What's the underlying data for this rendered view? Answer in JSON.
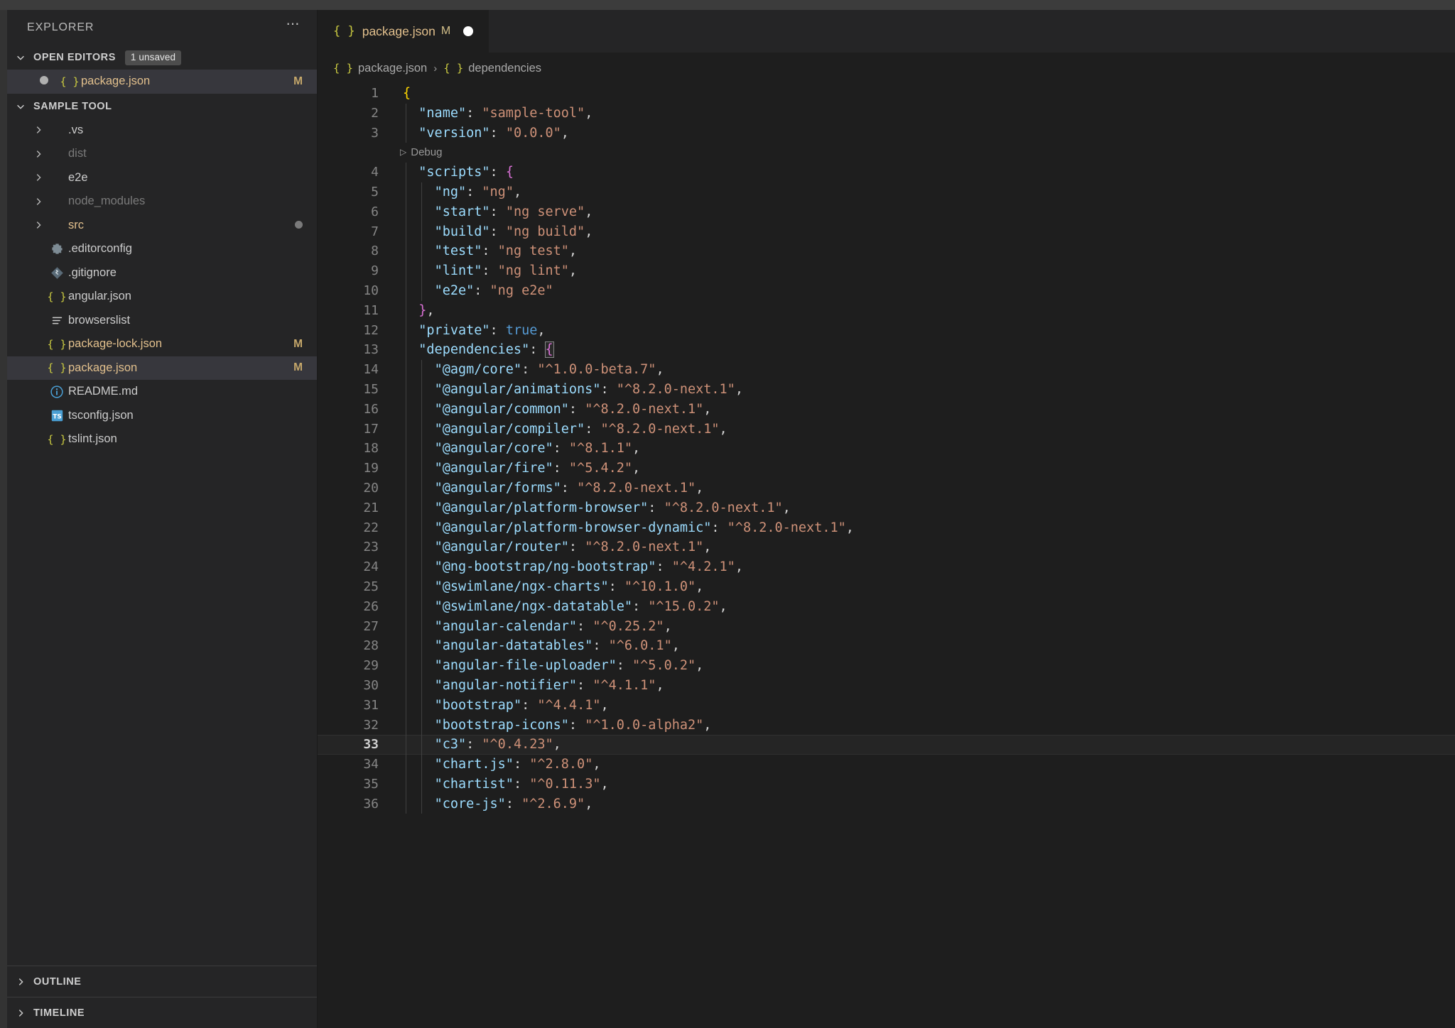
{
  "sidebar": {
    "title": "EXPLORER",
    "more_icon": "ellipsis-icon",
    "open_editors": {
      "label": "OPEN EDITORS",
      "badge": "1 unsaved",
      "items": [
        {
          "name": "package.json",
          "status": "M",
          "unsaved": true,
          "icon": "json-icon"
        }
      ]
    },
    "folder": {
      "label": "SAMPLE TOOL",
      "items": [
        {
          "label": ".vs",
          "type": "folder",
          "color": "normal",
          "status": ""
        },
        {
          "label": "dist",
          "type": "folder",
          "color": "dim",
          "status": ""
        },
        {
          "label": "e2e",
          "type": "folder",
          "color": "normal",
          "status": ""
        },
        {
          "label": "node_modules",
          "type": "folder",
          "color": "dim",
          "status": ""
        },
        {
          "label": "src",
          "type": "folder",
          "color": "amber",
          "status": "",
          "dot": true
        },
        {
          "label": ".editorconfig",
          "type": "file",
          "color": "normal",
          "status": "",
          "icon": "gear-icon"
        },
        {
          "label": ".gitignore",
          "type": "file",
          "color": "normal",
          "status": "",
          "icon": "git-icon"
        },
        {
          "label": "angular.json",
          "type": "file",
          "color": "normal",
          "status": "",
          "icon": "json-icon"
        },
        {
          "label": "browserslist",
          "type": "file",
          "color": "normal",
          "status": "",
          "icon": "list-icon"
        },
        {
          "label": "package-lock.json",
          "type": "file",
          "color": "amber",
          "status": "M",
          "icon": "json-icon"
        },
        {
          "label": "package.json",
          "type": "file",
          "color": "amber",
          "status": "M",
          "icon": "json-icon",
          "selected": true
        },
        {
          "label": "README.md",
          "type": "file",
          "color": "normal",
          "status": "",
          "icon": "info-icon"
        },
        {
          "label": "tsconfig.json",
          "type": "file",
          "color": "normal",
          "status": "",
          "icon": "ts-icon"
        },
        {
          "label": "tslint.json",
          "type": "file",
          "color": "normal",
          "status": "",
          "icon": "json-icon"
        }
      ]
    },
    "bottom_sections": [
      {
        "label": "OUTLINE"
      },
      {
        "label": "TIMELINE"
      }
    ]
  },
  "editor": {
    "tab": {
      "filename": "package.json",
      "status": "M",
      "dirty_icon": "circle-dot-icon",
      "file_icon": "json-icon"
    },
    "breadcrumbs": [
      {
        "label": "package.json",
        "icon": "json-icon"
      },
      {
        "label": "dependencies",
        "icon": "json-icon"
      }
    ],
    "codelens": {
      "label": "Debug",
      "icon": "play-icon",
      "line_after": 3
    },
    "current_line": 33,
    "added_lines": [
      19,
      32
    ],
    "unsaved_diff_lines": [
      2
    ],
    "lines": [
      {
        "n": 1,
        "indent": 0,
        "tokens": [
          {
            "t": "{",
            "c": "b1"
          }
        ]
      },
      {
        "n": 2,
        "indent": 1,
        "tokens": [
          {
            "t": "\"name\"",
            "c": "k"
          },
          {
            "t": ": ",
            "c": "p"
          },
          {
            "t": "\"sample-tool\"",
            "c": "s"
          },
          {
            "t": ",",
            "c": "p"
          }
        ]
      },
      {
        "n": 3,
        "indent": 1,
        "tokens": [
          {
            "t": "\"version\"",
            "c": "k"
          },
          {
            "t": ": ",
            "c": "p"
          },
          {
            "t": "\"0.0.0\"",
            "c": "s"
          },
          {
            "t": ",",
            "c": "p"
          }
        ]
      },
      {
        "n": 4,
        "indent": 1,
        "tokens": [
          {
            "t": "\"scripts\"",
            "c": "k"
          },
          {
            "t": ": ",
            "c": "p"
          },
          {
            "t": "{",
            "c": "b2"
          }
        ]
      },
      {
        "n": 5,
        "indent": 2,
        "tokens": [
          {
            "t": "\"ng\"",
            "c": "k"
          },
          {
            "t": ": ",
            "c": "p"
          },
          {
            "t": "\"ng\"",
            "c": "s"
          },
          {
            "t": ",",
            "c": "p"
          }
        ]
      },
      {
        "n": 6,
        "indent": 2,
        "tokens": [
          {
            "t": "\"start\"",
            "c": "k"
          },
          {
            "t": ": ",
            "c": "p"
          },
          {
            "t": "\"ng serve\"",
            "c": "s"
          },
          {
            "t": ",",
            "c": "p"
          }
        ]
      },
      {
        "n": 7,
        "indent": 2,
        "tokens": [
          {
            "t": "\"build\"",
            "c": "k"
          },
          {
            "t": ": ",
            "c": "p"
          },
          {
            "t": "\"ng build\"",
            "c": "s"
          },
          {
            "t": ",",
            "c": "p"
          }
        ]
      },
      {
        "n": 8,
        "indent": 2,
        "tokens": [
          {
            "t": "\"test\"",
            "c": "k"
          },
          {
            "t": ": ",
            "c": "p"
          },
          {
            "t": "\"ng test\"",
            "c": "s"
          },
          {
            "t": ",",
            "c": "p"
          }
        ]
      },
      {
        "n": 9,
        "indent": 2,
        "tokens": [
          {
            "t": "\"lint\"",
            "c": "k"
          },
          {
            "t": ": ",
            "c": "p"
          },
          {
            "t": "\"ng lint\"",
            "c": "s"
          },
          {
            "t": ",",
            "c": "p"
          }
        ]
      },
      {
        "n": 10,
        "indent": 2,
        "tokens": [
          {
            "t": "\"e2e\"",
            "c": "k"
          },
          {
            "t": ": ",
            "c": "p"
          },
          {
            "t": "\"ng e2e\"",
            "c": "s"
          }
        ]
      },
      {
        "n": 11,
        "indent": 1,
        "tokens": [
          {
            "t": "}",
            "c": "b2"
          },
          {
            "t": ",",
            "c": "p"
          }
        ]
      },
      {
        "n": 12,
        "indent": 1,
        "tokens": [
          {
            "t": "\"private\"",
            "c": "k"
          },
          {
            "t": ": ",
            "c": "p"
          },
          {
            "t": "true",
            "c": "kw"
          },
          {
            "t": ",",
            "c": "p"
          }
        ]
      },
      {
        "n": 13,
        "indent": 1,
        "tokens": [
          {
            "t": "\"dependencies\"",
            "c": "k"
          },
          {
            "t": ": ",
            "c": "p"
          },
          {
            "t": "{",
            "c": "b2 bmatch"
          }
        ]
      },
      {
        "n": 14,
        "indent": 2,
        "tokens": [
          {
            "t": "\"@agm/core\"",
            "c": "k"
          },
          {
            "t": ": ",
            "c": "p"
          },
          {
            "t": "\"^1.0.0-beta.7\"",
            "c": "s"
          },
          {
            "t": ",",
            "c": "p"
          }
        ]
      },
      {
        "n": 15,
        "indent": 2,
        "tokens": [
          {
            "t": "\"@angular/animations\"",
            "c": "k"
          },
          {
            "t": ": ",
            "c": "p"
          },
          {
            "t": "\"^8.2.0-next.1\"",
            "c": "s"
          },
          {
            "t": ",",
            "c": "p"
          }
        ]
      },
      {
        "n": 16,
        "indent": 2,
        "tokens": [
          {
            "t": "\"@angular/common\"",
            "c": "k"
          },
          {
            "t": ": ",
            "c": "p"
          },
          {
            "t": "\"^8.2.0-next.1\"",
            "c": "s"
          },
          {
            "t": ",",
            "c": "p"
          }
        ]
      },
      {
        "n": 17,
        "indent": 2,
        "tokens": [
          {
            "t": "\"@angular/compiler\"",
            "c": "k"
          },
          {
            "t": ": ",
            "c": "p"
          },
          {
            "t": "\"^8.2.0-next.1\"",
            "c": "s"
          },
          {
            "t": ",",
            "c": "p"
          }
        ]
      },
      {
        "n": 18,
        "indent": 2,
        "tokens": [
          {
            "t": "\"@angular/core\"",
            "c": "k"
          },
          {
            "t": ": ",
            "c": "p"
          },
          {
            "t": "\"^8.1.1\"",
            "c": "s"
          },
          {
            "t": ",",
            "c": "p"
          }
        ]
      },
      {
        "n": 19,
        "indent": 2,
        "tokens": [
          {
            "t": "\"@angular/fire\"",
            "c": "k"
          },
          {
            "t": ": ",
            "c": "p"
          },
          {
            "t": "\"^5.4.2\"",
            "c": "s"
          },
          {
            "t": ",",
            "c": "p"
          }
        ]
      },
      {
        "n": 20,
        "indent": 2,
        "tokens": [
          {
            "t": "\"@angular/forms\"",
            "c": "k"
          },
          {
            "t": ": ",
            "c": "p"
          },
          {
            "t": "\"^8.2.0-next.1\"",
            "c": "s"
          },
          {
            "t": ",",
            "c": "p"
          }
        ]
      },
      {
        "n": 21,
        "indent": 2,
        "tokens": [
          {
            "t": "\"@angular/platform-browser\"",
            "c": "k"
          },
          {
            "t": ": ",
            "c": "p"
          },
          {
            "t": "\"^8.2.0-next.1\"",
            "c": "s"
          },
          {
            "t": ",",
            "c": "p"
          }
        ]
      },
      {
        "n": 22,
        "indent": 2,
        "tokens": [
          {
            "t": "\"@angular/platform-browser-dynamic\"",
            "c": "k"
          },
          {
            "t": ": ",
            "c": "p"
          },
          {
            "t": "\"^8.2.0-next.1\"",
            "c": "s"
          },
          {
            "t": ",",
            "c": "p"
          }
        ]
      },
      {
        "n": 23,
        "indent": 2,
        "tokens": [
          {
            "t": "\"@angular/router\"",
            "c": "k"
          },
          {
            "t": ": ",
            "c": "p"
          },
          {
            "t": "\"^8.2.0-next.1\"",
            "c": "s"
          },
          {
            "t": ",",
            "c": "p"
          }
        ]
      },
      {
        "n": 24,
        "indent": 2,
        "tokens": [
          {
            "t": "\"@ng-bootstrap/ng-bootstrap\"",
            "c": "k"
          },
          {
            "t": ": ",
            "c": "p"
          },
          {
            "t": "\"^4.2.1\"",
            "c": "s"
          },
          {
            "t": ",",
            "c": "p"
          }
        ]
      },
      {
        "n": 25,
        "indent": 2,
        "tokens": [
          {
            "t": "\"@swimlane/ngx-charts\"",
            "c": "k"
          },
          {
            "t": ": ",
            "c": "p"
          },
          {
            "t": "\"^10.1.0\"",
            "c": "s"
          },
          {
            "t": ",",
            "c": "p"
          }
        ]
      },
      {
        "n": 26,
        "indent": 2,
        "tokens": [
          {
            "t": "\"@swimlane/ngx-datatable\"",
            "c": "k"
          },
          {
            "t": ": ",
            "c": "p"
          },
          {
            "t": "\"^15.0.2\"",
            "c": "s"
          },
          {
            "t": ",",
            "c": "p"
          }
        ]
      },
      {
        "n": 27,
        "indent": 2,
        "tokens": [
          {
            "t": "\"angular-calendar\"",
            "c": "k"
          },
          {
            "t": ": ",
            "c": "p"
          },
          {
            "t": "\"^0.25.2\"",
            "c": "s"
          },
          {
            "t": ",",
            "c": "p"
          }
        ]
      },
      {
        "n": 28,
        "indent": 2,
        "tokens": [
          {
            "t": "\"angular-datatables\"",
            "c": "k"
          },
          {
            "t": ": ",
            "c": "p"
          },
          {
            "t": "\"^6.0.1\"",
            "c": "s"
          },
          {
            "t": ",",
            "c": "p"
          }
        ]
      },
      {
        "n": 29,
        "indent": 2,
        "tokens": [
          {
            "t": "\"angular-file-uploader\"",
            "c": "k"
          },
          {
            "t": ": ",
            "c": "p"
          },
          {
            "t": "\"^5.0.2\"",
            "c": "s"
          },
          {
            "t": ",",
            "c": "p"
          }
        ]
      },
      {
        "n": 30,
        "indent": 2,
        "tokens": [
          {
            "t": "\"angular-notifier\"",
            "c": "k"
          },
          {
            "t": ": ",
            "c": "p"
          },
          {
            "t": "\"^4.1.1\"",
            "c": "s"
          },
          {
            "t": ",",
            "c": "p"
          }
        ]
      },
      {
        "n": 31,
        "indent": 2,
        "tokens": [
          {
            "t": "\"bootstrap\"",
            "c": "k"
          },
          {
            "t": ": ",
            "c": "p"
          },
          {
            "t": "\"^4.4.1\"",
            "c": "s"
          },
          {
            "t": ",",
            "c": "p"
          }
        ]
      },
      {
        "n": 32,
        "indent": 2,
        "tokens": [
          {
            "t": "\"bootstrap-icons\"",
            "c": "k"
          },
          {
            "t": ": ",
            "c": "p"
          },
          {
            "t": "\"^1.0.0-alpha2\"",
            "c": "s"
          },
          {
            "t": ",",
            "c": "p"
          }
        ]
      },
      {
        "n": 33,
        "indent": 2,
        "tokens": [
          {
            "t": "\"c3\"",
            "c": "k"
          },
          {
            "t": ": ",
            "c": "p"
          },
          {
            "t": "\"^0.4.23\"",
            "c": "s"
          },
          {
            "t": ",",
            "c": "p"
          }
        ]
      },
      {
        "n": 34,
        "indent": 2,
        "tokens": [
          {
            "t": "\"chart.js\"",
            "c": "k"
          },
          {
            "t": ": ",
            "c": "p"
          },
          {
            "t": "\"^2.8.0\"",
            "c": "s"
          },
          {
            "t": ",",
            "c": "p"
          }
        ]
      },
      {
        "n": 35,
        "indent": 2,
        "tokens": [
          {
            "t": "\"chartist\"",
            "c": "k"
          },
          {
            "t": ": ",
            "c": "p"
          },
          {
            "t": "\"^0.11.3\"",
            "c": "s"
          },
          {
            "t": ",",
            "c": "p"
          }
        ]
      },
      {
        "n": 36,
        "indent": 2,
        "tokens": [
          {
            "t": "\"core-js\"",
            "c": "k"
          },
          {
            "t": ": ",
            "c": "p"
          },
          {
            "t": "\"^2.6.9\"",
            "c": "s"
          },
          {
            "t": ",",
            "c": "p"
          }
        ]
      }
    ]
  },
  "colors": {
    "editor_bg": "#1e1e1e",
    "sidebar_bg": "#252526",
    "selected_row": "#37373d",
    "modified_amber": "#e2c08d",
    "added_green": "#7cb342",
    "json_icon": "#cbcb41",
    "key_blue": "#9cdcfe",
    "string_orange": "#ce9178"
  }
}
